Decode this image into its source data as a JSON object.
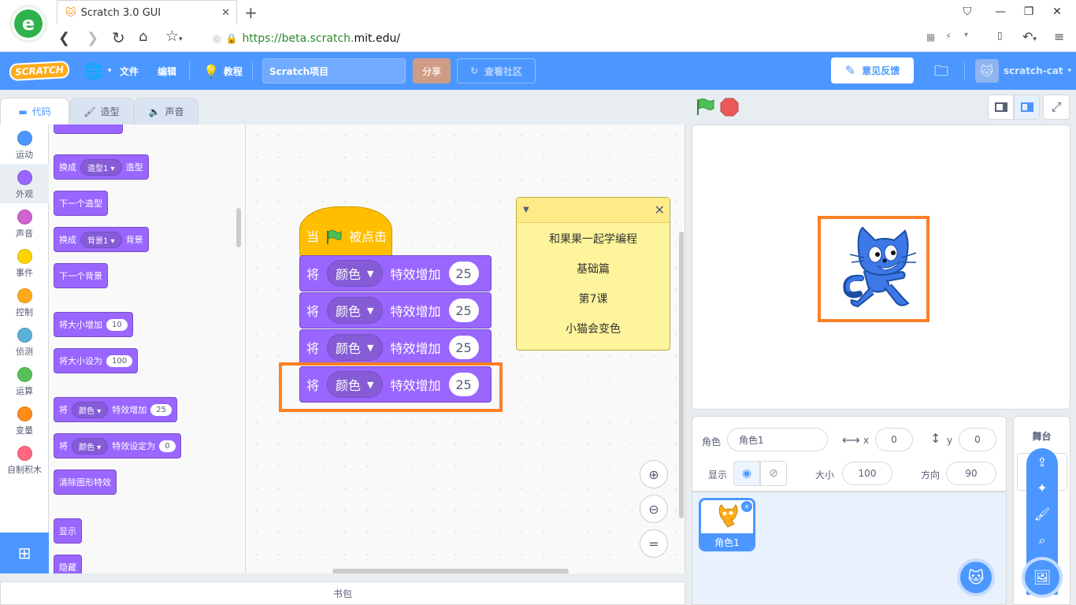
{
  "browser": {
    "tab_title": "Scratch 3.0 GUI",
    "url_prefix": "https://beta.scratch.",
    "url_domain": "mit.edu",
    "url_suffix": "/"
  },
  "menubar": {
    "logo": "SCRATCH",
    "file": "文件",
    "edit": "编辑",
    "tutorials": "教程",
    "project_title": "Scratch项目",
    "share": "分享",
    "see_community": "查看社区",
    "feedback": "意见反馈",
    "username": "scratch-cat",
    "colors": {
      "bar": "#4c97ff",
      "share_bg": "#ce9c85"
    }
  },
  "editor_tabs": {
    "code": "代码",
    "costumes": "造型",
    "sounds": "声音"
  },
  "categories": [
    {
      "label": "运动",
      "color": "#4c97ff"
    },
    {
      "label": "外观",
      "color": "#9966ff"
    },
    {
      "label": "声音",
      "color": "#cf63cf"
    },
    {
      "label": "事件",
      "color": "#ffd500"
    },
    {
      "label": "控制",
      "color": "#ffab19"
    },
    {
      "label": "侦测",
      "color": "#5cb1d6"
    },
    {
      "label": "运算",
      "color": "#59c059"
    },
    {
      "label": "变量",
      "color": "#ff8c1a"
    },
    {
      "label": "自制积木",
      "color": "#ff6680"
    }
  ],
  "palette": {
    "switch_costume": {
      "a": "换成",
      "dd": "造型1",
      "b": "造型"
    },
    "next_costume": "下一个造型",
    "switch_backdrop": {
      "a": "换成",
      "dd": "背景1",
      "b": "背景"
    },
    "next_backdrop": "下一个背景",
    "change_size": {
      "a": "将大小增加",
      "val": "10"
    },
    "set_size": {
      "a": "将大小设为",
      "val": "100"
    },
    "change_effect": {
      "a": "将",
      "dd": "颜色",
      "b": "特效增加",
      "val": "25"
    },
    "set_effect": {
      "a": "将",
      "dd": "颜色",
      "b": "特效设定为",
      "val": "0"
    },
    "clear_effects": "清除图形特效",
    "show": "显示",
    "hide": "隐藏"
  },
  "script": {
    "hat": {
      "a": "当",
      "b": "被点击"
    },
    "blocks": [
      {
        "a": "将",
        "dd": "颜色",
        "b": "特效增加",
        "val": "25"
      },
      {
        "a": "将",
        "dd": "颜色",
        "b": "特效增加",
        "val": "25"
      },
      {
        "a": "将",
        "dd": "颜色",
        "b": "特效增加",
        "val": "25"
      },
      {
        "a": "将",
        "dd": "颜色",
        "b": "特效增加",
        "val": "25"
      }
    ]
  },
  "note": {
    "lines": [
      "和果果一起学编程",
      "基础篇",
      "第7课",
      "小猫会变色"
    ]
  },
  "sprite_info": {
    "sprite_label": "角色",
    "sprite_name": "角色1",
    "x_label": "x",
    "x": "0",
    "y_label": "y",
    "y": "0",
    "show_label": "显示",
    "size_label": "大小",
    "size": "100",
    "direction_label": "方向",
    "direction": "90"
  },
  "sprites": [
    {
      "name": "角色1"
    }
  ],
  "stage_panel": {
    "title": "舞台"
  },
  "backpack": "书包",
  "highlight_color": "#ff7f27"
}
